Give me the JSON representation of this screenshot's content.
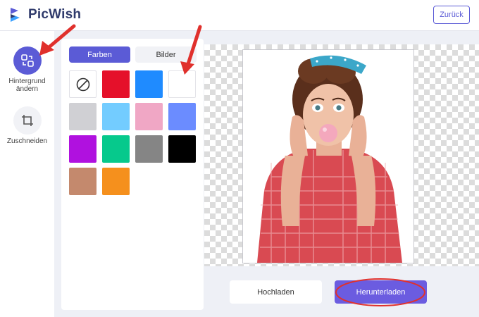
{
  "header": {
    "logo_text": "PicWish",
    "back_label": "Zurück",
    "brand_color": "#5b5bd6"
  },
  "left_rail": {
    "tools": [
      {
        "label": "Hintergrund ändern",
        "icon": "swap-background-icon",
        "active": true
      },
      {
        "label": "Zuschneiden",
        "icon": "crop-icon",
        "active": false
      }
    ]
  },
  "panel": {
    "tabs": [
      {
        "label": "Farben",
        "active": true
      },
      {
        "label": "Bilder",
        "active": false
      }
    ],
    "swatches": [
      {
        "color": "none",
        "icon": "no-color-icon"
      },
      {
        "color": "#e5102a"
      },
      {
        "color": "#1f8bff"
      },
      {
        "color": "#ffffff"
      },
      {
        "color": "#d0d0d4"
      },
      {
        "color": "#73ccff"
      },
      {
        "color": "#f0a7c5"
      },
      {
        "color": "#6b8cff"
      },
      {
        "color": "#b011df"
      },
      {
        "color": "#06c98c"
      },
      {
        "color": "#858585"
      },
      {
        "color": "#000000"
      },
      {
        "color": "#c4896d"
      },
      {
        "color": "#f5901d"
      }
    ]
  },
  "canvas": {
    "subject": "woman-blowing-bubblegum-photo"
  },
  "actions": {
    "upload_label": "Hochladen",
    "download_label": "Herunterladen"
  },
  "annotations": {
    "arrow_color": "#e0302c"
  }
}
